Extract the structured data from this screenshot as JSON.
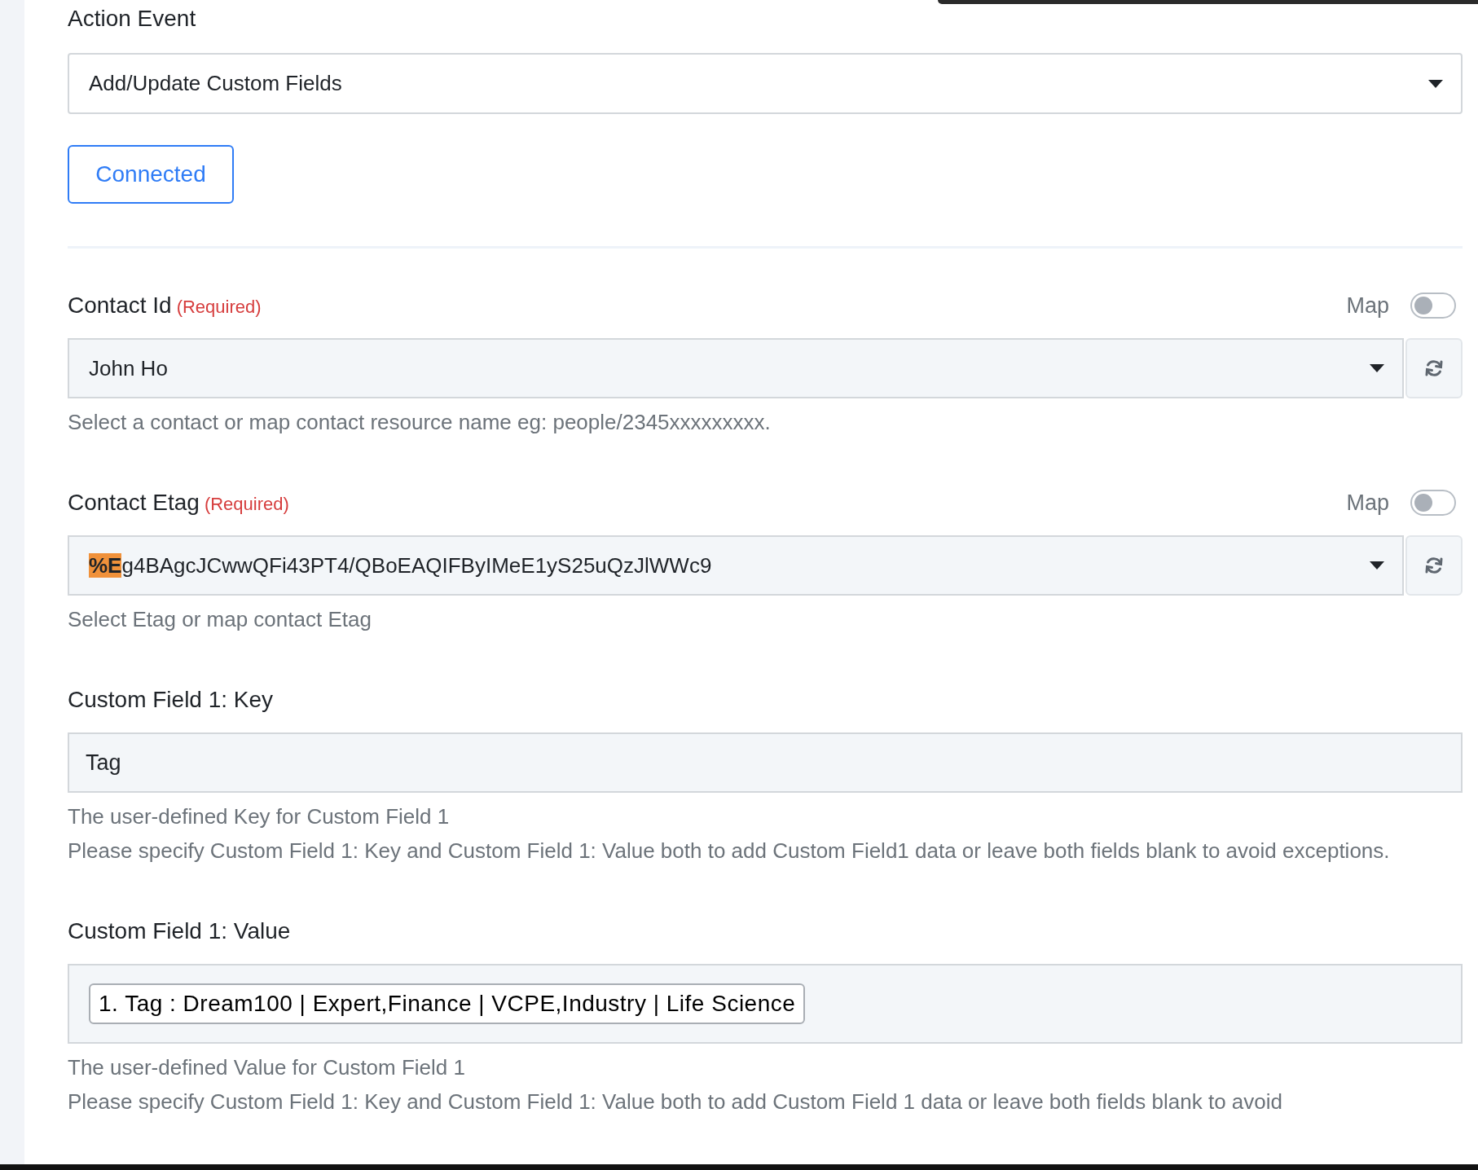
{
  "action_event": {
    "label": "Action Event",
    "value": "Add/Update Custom Fields"
  },
  "connection_button": {
    "label": "Connected"
  },
  "fields": [
    {
      "kind": "select",
      "label": "Contact Id",
      "required_label": "(Required)",
      "map_label": "Map",
      "map_on": false,
      "value": [
        {
          "text": "John Ho",
          "highlighted": false
        }
      ],
      "help": [
        "Select a contact or map contact resource name eg: people/2345xxxxxxxxx."
      ]
    },
    {
      "kind": "select",
      "label": "Contact Etag",
      "required_label": "(Required)",
      "map_label": "Map",
      "map_on": false,
      "value": [
        {
          "text": "%E",
          "highlighted": true
        },
        {
          "text": "g4BAgcJCwwQFi43PT4/QBoEAQIFByIMeE1yS25uQzJlWWc9",
          "highlighted": false
        }
      ],
      "help": [
        "Select Etag or map contact Etag"
      ]
    },
    {
      "kind": "text",
      "label": "Custom Field 1: Key",
      "value": "Tag",
      "help": [
        "The user-defined Key for Custom Field 1",
        "Please specify Custom Field 1: Key and Custom Field 1: Value both to add Custom Field1 data or leave both fields blank to avoid exceptions."
      ]
    },
    {
      "kind": "chips",
      "label": "Custom Field 1: Value",
      "chips": [
        "1. Tag : Dream100 | Expert,Finance | VCPE,Industry | Life Science"
      ],
      "help": [
        "The user-defined Value for Custom Field 1",
        "Please specify Custom Field 1: Key and Custom Field 1: Value both to add Custom Field 1 data or leave both fields blank to avoid"
      ]
    }
  ]
}
